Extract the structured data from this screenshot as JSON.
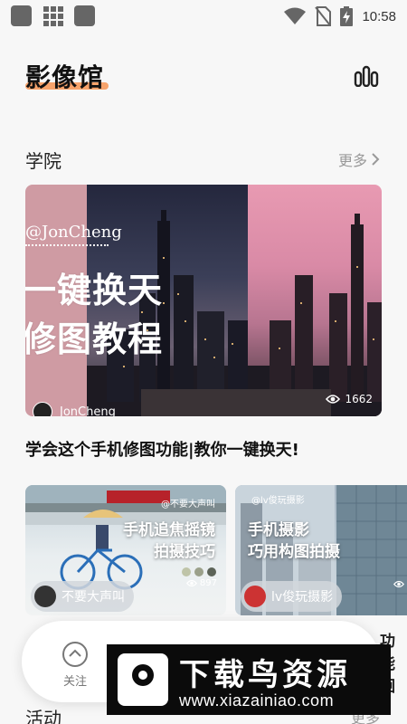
{
  "status_bar": {
    "time": "10:58",
    "icons": [
      "app-icon",
      "grid-icon",
      "app-icon",
      "wifi-icon",
      "no-sim-icon",
      "battery-charging-icon"
    ]
  },
  "header": {
    "title": "影像馆",
    "right_icon": "stats-icon"
  },
  "academy": {
    "title": "学院",
    "more_label": "更多",
    "featured": {
      "handle": "@JonCheng",
      "overlay_line1": "一键换天",
      "overlay_line2": "修图教程",
      "author": "JonCheng",
      "views": "1662",
      "caption": "学会这个手机修图功能|教你一键换天!"
    },
    "cards": [
      {
        "tag": "@不要大声叫",
        "line1": "手机追焦摇镜",
        "line2": "拍摄技巧",
        "author": "不要大声叫",
        "views": "897"
      },
      {
        "tag": "@lv俊玩摄影",
        "line1": "手机摄影",
        "line2": "巧用构图拍摄",
        "author": "lv俊玩摄影",
        "views": ""
      }
    ],
    "peek_text": "功能徊"
  },
  "bottom_nav": {
    "items": [
      {
        "label": "关注",
        "icon": "follow-icon"
      }
    ]
  },
  "activity": {
    "title": "活动",
    "more_label": "更多"
  },
  "watermark": {
    "title": "下载鸟资源",
    "url": "www.xiazainiao.com"
  },
  "colors": {
    "accent_highlight": "#f7a36b",
    "background": "#f7f7f7",
    "muted": "#999999"
  }
}
